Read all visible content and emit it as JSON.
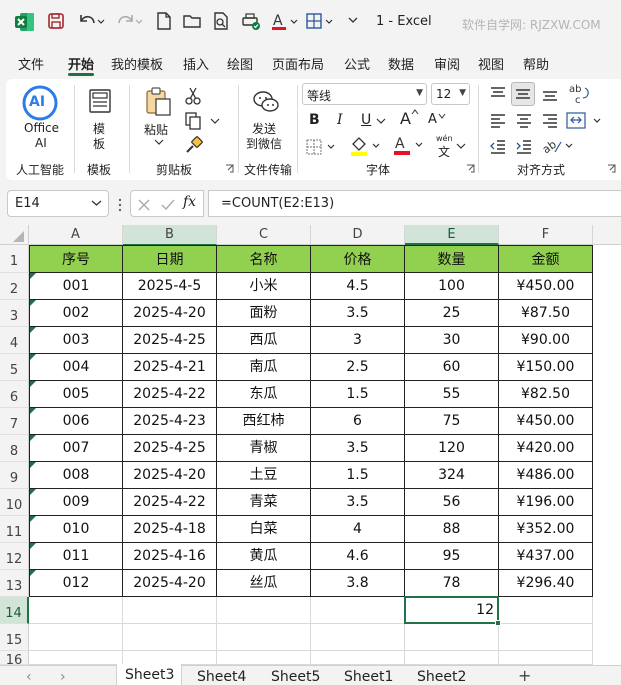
{
  "titlebar": {
    "title": "1  -  Excel",
    "watermark": "软件自学网: RJZXW.COM"
  },
  "menu": [
    "文件",
    "开始",
    "我的模板",
    "插入",
    "绘图",
    "页面布局",
    "公式",
    "数据",
    "审阅",
    "视图",
    "帮助"
  ],
  "ribbon": {
    "office_ai_line1": "Office",
    "office_ai_line2": "AI",
    "ai_badge": "AI",
    "group_ai": "人工智能",
    "template_line1": "模",
    "template_line2": "板",
    "group_template": "模板",
    "paste": "粘贴",
    "group_clipboard": "剪贴板",
    "send_line1": "发送",
    "send_line2": "到微信",
    "group_transfer": "文件传输",
    "font_name": "等线",
    "font_size": "12",
    "bold": "B",
    "italic": "I",
    "underline": "U",
    "font_color_a": "A",
    "highlight_a": "A",
    "wen": "wén",
    "wen_char": "文",
    "group_font": "字体",
    "group_align": "对齐方式",
    "abc": "abc",
    "colors": {
      "accent": "#1e7145",
      "highlight": "#ffff00",
      "font_red": "#e81123",
      "header_fill": "#92d050"
    }
  },
  "formula_bar": {
    "name_box": "E14",
    "fx": "fx",
    "formula": "=COUNT(E2:E13)"
  },
  "grid": {
    "columns": [
      "A",
      "B",
      "C",
      "D",
      "E",
      "F"
    ],
    "row_numbers": [
      "1",
      "2",
      "3",
      "4",
      "5",
      "6",
      "7",
      "8",
      "9",
      "10",
      "11",
      "12",
      "13",
      "14",
      "15",
      "16"
    ],
    "headers": [
      "序号",
      "日期",
      "名称",
      "价格",
      "数量",
      "金额"
    ],
    "rows": [
      [
        "001",
        "2025-4-5",
        "小米",
        "4.5",
        "100",
        "¥450.00"
      ],
      [
        "002",
        "2025-4-20",
        "面粉",
        "3.5",
        "25",
        "¥87.50"
      ],
      [
        "003",
        "2025-4-25",
        "西瓜",
        "3",
        "30",
        "¥90.00"
      ],
      [
        "004",
        "2025-4-21",
        "南瓜",
        "2.5",
        "60",
        "¥150.00"
      ],
      [
        "005",
        "2025-4-22",
        "东瓜",
        "1.5",
        "55",
        "¥82.50"
      ],
      [
        "006",
        "2025-4-23",
        "西红柿",
        "6",
        "75",
        "¥450.00"
      ],
      [
        "007",
        "2025-4-25",
        "青椒",
        "3.5",
        "120",
        "¥420.00"
      ],
      [
        "008",
        "2025-4-20",
        "土豆",
        "1.5",
        "324",
        "¥486.00"
      ],
      [
        "009",
        "2025-4-22",
        "青菜",
        "3.5",
        "56",
        "¥196.00"
      ],
      [
        "010",
        "2025-4-18",
        "白菜",
        "4",
        "88",
        "¥352.00"
      ],
      [
        "011",
        "2025-4-16",
        "黄瓜",
        "4.6",
        "95",
        "¥437.00"
      ],
      [
        "012",
        "2025-4-20",
        "丝瓜",
        "3.8",
        "78",
        "¥296.40"
      ]
    ],
    "result_cell": "12",
    "selected_cell": "E14"
  },
  "tabs": {
    "prev": "‹",
    "next": "›",
    "sheets": [
      "Sheet3",
      "Sheet4",
      "Sheet5",
      "Sheet1",
      "Sheet2"
    ],
    "active": "Sheet3",
    "add": "+"
  }
}
